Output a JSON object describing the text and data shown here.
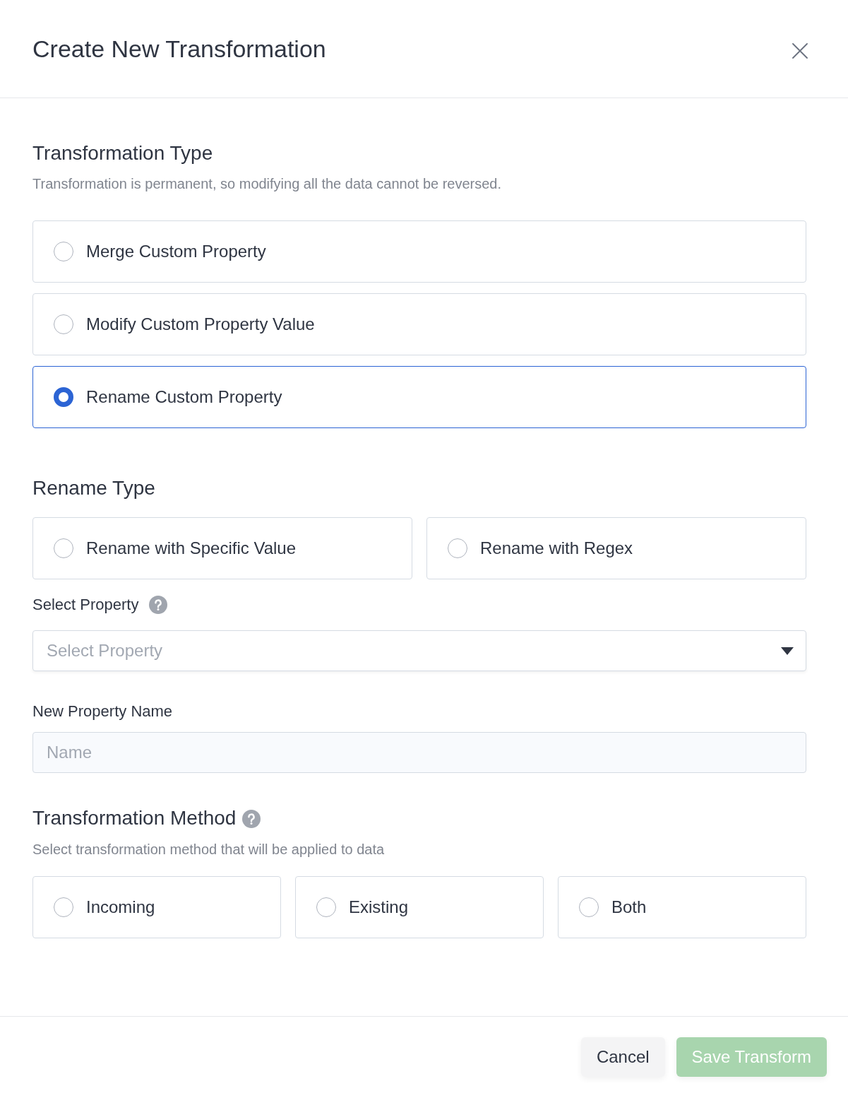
{
  "dialog": {
    "title": "Create New Transformation"
  },
  "transformation_type": {
    "heading": "Transformation Type",
    "description": "Transformation is permanent, so modifying all the data cannot be reversed.",
    "options": [
      {
        "label": "Merge Custom Property",
        "selected": false
      },
      {
        "label": "Modify Custom Property Value",
        "selected": false
      },
      {
        "label": "Rename Custom Property",
        "selected": true
      }
    ]
  },
  "rename_type": {
    "heading": "Rename Type",
    "options": [
      {
        "label": "Rename with Specific Value",
        "selected": false
      },
      {
        "label": "Rename with Regex",
        "selected": false
      }
    ]
  },
  "select_property": {
    "label": "Select Property",
    "placeholder": "Select Property"
  },
  "new_property_name": {
    "label": "New Property Name",
    "placeholder": "Name"
  },
  "transformation_method": {
    "heading": "Transformation Method",
    "description": "Select transformation method that will be applied to data",
    "options": [
      {
        "label": "Incoming",
        "selected": false
      },
      {
        "label": "Existing",
        "selected": false
      },
      {
        "label": "Both",
        "selected": false
      }
    ]
  },
  "footer": {
    "buttons": [
      {
        "label": "Cancel",
        "kind": "secondary",
        "disabled": false
      },
      {
        "label": "Save Transform",
        "kind": "primary",
        "disabled": true
      }
    ]
  }
}
